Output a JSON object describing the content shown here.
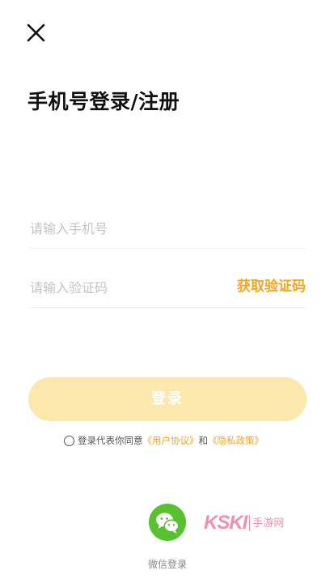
{
  "header": {
    "title": "手机号登录/注册"
  },
  "form": {
    "phone_placeholder": "请输入手机号",
    "code_placeholder": "请输入验证码",
    "get_code_label": "获取验证码",
    "login_label": "登录"
  },
  "agreement": {
    "prefix": "登录代表你同意",
    "user_agreement": "《用户协议》",
    "and": "和",
    "privacy_policy": "《隐私政策》"
  },
  "wechat": {
    "label": "微信登录"
  },
  "watermark": {
    "logo": "KSKI",
    "text": "手游网"
  },
  "colors": {
    "accent": "#f2a623",
    "login_button_bg": "#fce7ad",
    "wechat_green": "#58c12e"
  },
  "icons": {
    "close": "close-icon",
    "wechat": "wechat-icon",
    "radio": "radio-unchecked-icon"
  }
}
